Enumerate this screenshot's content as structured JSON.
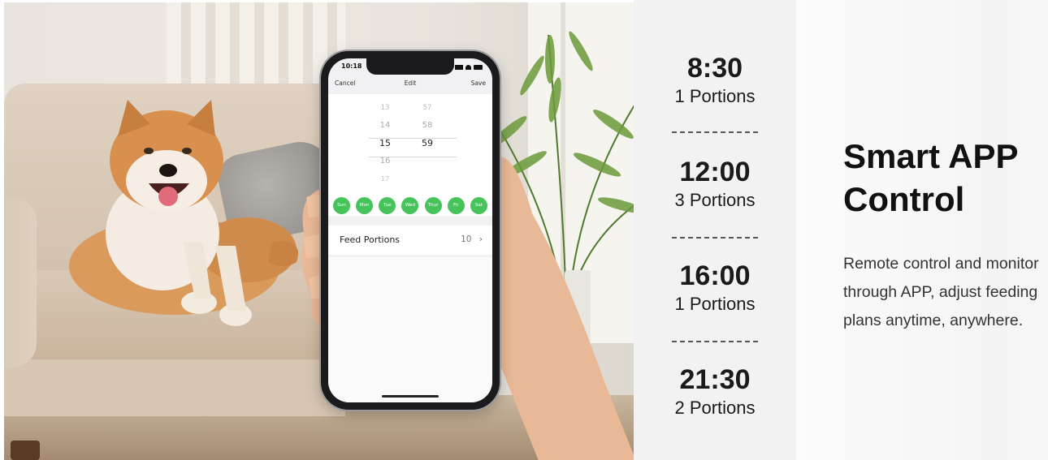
{
  "phone": {
    "status_time": "10:18",
    "nav": {
      "cancel": "Cancel",
      "title": "Edit",
      "save": "Save"
    },
    "picker_hours": [
      "13",
      "14",
      "15",
      "16",
      "17"
    ],
    "picker_minutes": [
      "57",
      "58",
      "59"
    ],
    "days": [
      "Sun",
      "Mon",
      "Tue",
      "Wed",
      "Thur",
      "Fri",
      "Sat"
    ],
    "feed_row": {
      "label": "Feed Portions",
      "value": "10"
    }
  },
  "schedule": [
    {
      "time": "8:30",
      "portions": "1 Portions"
    },
    {
      "time": "12:00",
      "portions": "3 Portions"
    },
    {
      "time": "16:00",
      "portions": "1 Portions"
    },
    {
      "time": "21:30",
      "portions": "2 Portions"
    }
  ],
  "headline": {
    "line1": "Smart APP",
    "line2": "Control"
  },
  "description": {
    "line1": "Remote control and monitor",
    "line2": "through APP, adjust feeding",
    "line3": "plans anytime, anywhere."
  },
  "colors": {
    "day_active": "#46c35b",
    "schedule_bg": "#f2f2f2"
  }
}
